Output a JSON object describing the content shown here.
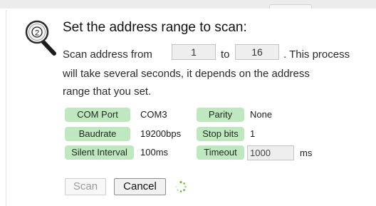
{
  "step": {
    "number": "2",
    "title": "Set the address range to scan:"
  },
  "scan": {
    "from_label": "Scan address from",
    "from_value": "1",
    "to_label": "to",
    "to_value": "16",
    "note_line1": ". This process",
    "note_line2": "will take several seconds, it depends on the address",
    "note_line3": "range that you set."
  },
  "settings": {
    "com_port_label": "COM Port",
    "com_port_value": "COM3",
    "parity_label": "Parity",
    "parity_value": "None",
    "baudrate_label": "Baudrate",
    "baudrate_value": "19200bps",
    "stop_bits_label": "Stop bits",
    "stop_bits_value": "1",
    "silent_interval_label": "Silent Interval",
    "silent_interval_value": "100ms",
    "timeout_label": "Timeout",
    "timeout_value": "1000",
    "timeout_unit": "ms"
  },
  "buttons": {
    "scan_label": "Scan",
    "cancel_label": "Cancel"
  },
  "colors": {
    "badge_bg": "#bfe8c0",
    "spinner": "#6abf3a"
  },
  "icons": {
    "step": "magnifier-step-icon",
    "loading": "loading-spinner-icon"
  }
}
